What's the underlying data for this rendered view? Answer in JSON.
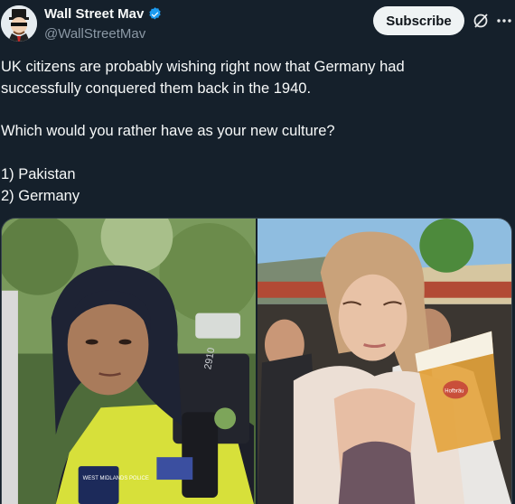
{
  "author": {
    "display_name": "Wall Street Mav",
    "handle": "@WallStreetMav",
    "verified": true
  },
  "header": {
    "subscribe_label": "Subscribe"
  },
  "tweet": {
    "text": "UK citizens are probably wishing right now that Germany had\nsuccessfully conquered them back in the 1940.\n\nWhich would you rather have as your new culture?\n\n1) Pakistan\n2) Germany"
  },
  "media": {
    "left_badge_text": "2910",
    "left_patch_text": "WEST MIDLANDS POLICE",
    "right_mug_label": "Hofbräu"
  },
  "colors": {
    "background": "#15202b",
    "verified_blue": "#1d9bf0",
    "secondary_text": "#8b98a5"
  },
  "icons": [
    "avatar",
    "verified-badge-icon",
    "grok-icon",
    "more-icon"
  ]
}
